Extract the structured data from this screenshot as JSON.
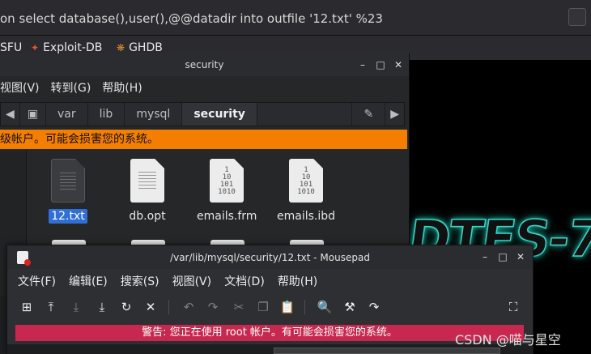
{
  "browser": {
    "url": "on select database(),user(),@@datadir into outfile '12.txt' %23",
    "bookmarks": [
      {
        "label": "SFU",
        "icon": ""
      },
      {
        "label": "Exploit-DB",
        "icon": "exploit-db-icon"
      },
      {
        "label": "GHDB",
        "icon": "ghdb-icon"
      }
    ],
    "page_text": "DTES-7"
  },
  "file_manager": {
    "title": "security",
    "menu": [
      "视图(V)",
      "转到(G)",
      "帮助(H)"
    ],
    "path": [
      "var",
      "lib",
      "mysql",
      "security"
    ],
    "warning": "级帐户。可能会损害您的系统。",
    "files": [
      {
        "name": "12.txt",
        "type": "text",
        "selected": true
      },
      {
        "name": "db.opt",
        "type": "text",
        "selected": false
      },
      {
        "name": "emails.frm",
        "type": "binary",
        "selected": false
      },
      {
        "name": "emails.ibd",
        "type": "binary",
        "selected": false
      }
    ],
    "binary_glyph": "1\n10\n101\n1010"
  },
  "mousepad": {
    "title": "/var/lib/mysql/security/12.txt - Mousepad",
    "menu": [
      "文件(F)",
      "编辑(E)",
      "搜索(S)",
      "视图(V)",
      "文档(D)",
      "帮助(H)"
    ],
    "warning": "警告: 您正在使用 root 帐户。有可能会损害您的系统。",
    "toolbar_icons": [
      "new-file-icon",
      "open-icon",
      "save-icon",
      "save-as-icon",
      "reload-icon",
      "close-icon",
      "undo-icon",
      "redo-icon",
      "cut-icon",
      "copy-icon",
      "paste-icon",
      "find-icon",
      "find-replace-icon",
      "goto-icon",
      "fullscreen-icon"
    ]
  },
  "watermark": "CSDN @喵与星空",
  "colors": {
    "file_manager_warning": "#f47e00",
    "mousepad_warning": "#c8284f",
    "selection": "#2f6fd6",
    "neon": "#3ad7c6"
  }
}
